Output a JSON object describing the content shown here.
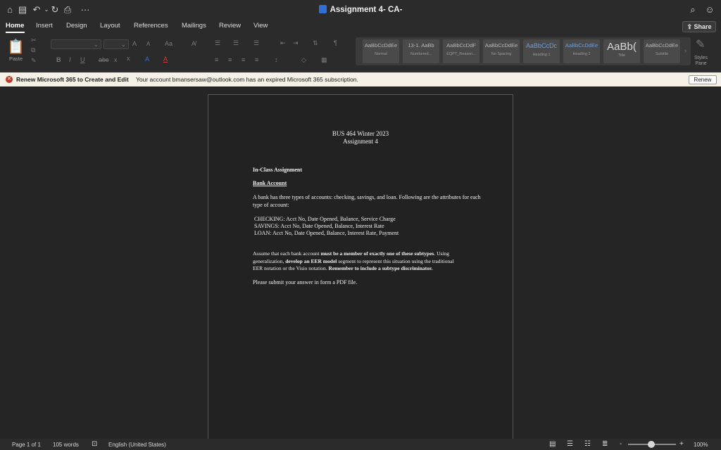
{
  "window": {
    "title": "Assignment 4- CA-"
  },
  "quick_access": {
    "more": "···"
  },
  "tabs": [
    "Home",
    "Insert",
    "Design",
    "Layout",
    "References",
    "Mailings",
    "Review",
    "View"
  ],
  "share_label": "Share",
  "ribbon": {
    "paste_label": "Paste",
    "font_size_up": "A",
    "font_size_down": "A",
    "change_case": "Aa",
    "bold": "B",
    "italic": "I",
    "underline": "U",
    "strike": "abc",
    "subscript": "x",
    "superscript": "x",
    "styles_pane_label": "Styles\nPane",
    "styles": [
      {
        "sample": "AaBbCcDdEe",
        "name": "Normal"
      },
      {
        "sample": "13-1. AaBb",
        "name": "Numbered..."
      },
      {
        "sample": "AaBbCcDdF",
        "name": "EQPT_Reason..."
      },
      {
        "sample": "AaBbCcDdEe",
        "name": "No Spacing"
      },
      {
        "sample": "AaBbCcDc",
        "name": "Heading 1"
      },
      {
        "sample": "AaBbCcDdEe",
        "name": "Heading 2"
      },
      {
        "sample": "AaBb(",
        "name": "Title"
      },
      {
        "sample": "AaBbCcDdEe",
        "name": "Subtitle"
      }
    ]
  },
  "notice": {
    "title": "Renew Microsoft 365 to Create and Edit",
    "message": "Your account bmansersaw@outlook.com has an expired Microsoft 365 subscription.",
    "button": "Renew"
  },
  "document": {
    "heading1": "BUS 464 Winter 2023",
    "heading2": "Assignment 4",
    "section": "In-Class Assignment",
    "subsection": "Bank Account",
    "intro": "A bank has three types of accounts: checking, savings, and loan. Following are the attributes for each type of account:",
    "checking": "CHECKING: Acct No, Date Opened, Balance, Service Charge",
    "savings": "SAVINGS: Acct No, Date Opened, Balance, Interest Rate",
    "loan": "LOAN: Acct No, Date Opened, Balance, Interest Rate, Payment",
    "p_a1": "Assume that each bank account ",
    "p_b1": "must be a member of exactly one of these subtypes",
    "p_a2": ". Using",
    "p_a3": "generalization, ",
    "p_b2": "develop an EER model",
    "p_a4": " segment to represent this situation using the traditional",
    "p_a5": "EER notation or the Visio notation. ",
    "p_b3": "Remember to include a subtype discriminator.",
    "submit": "Please submit your answer in form a PDF file."
  },
  "status": {
    "page": "Page 1 of 1",
    "words": "105 words",
    "language": "English (United States)",
    "zoom_minus": "-",
    "zoom_plus": "+",
    "zoom": "100%",
    "zoom_level": 1.0
  }
}
